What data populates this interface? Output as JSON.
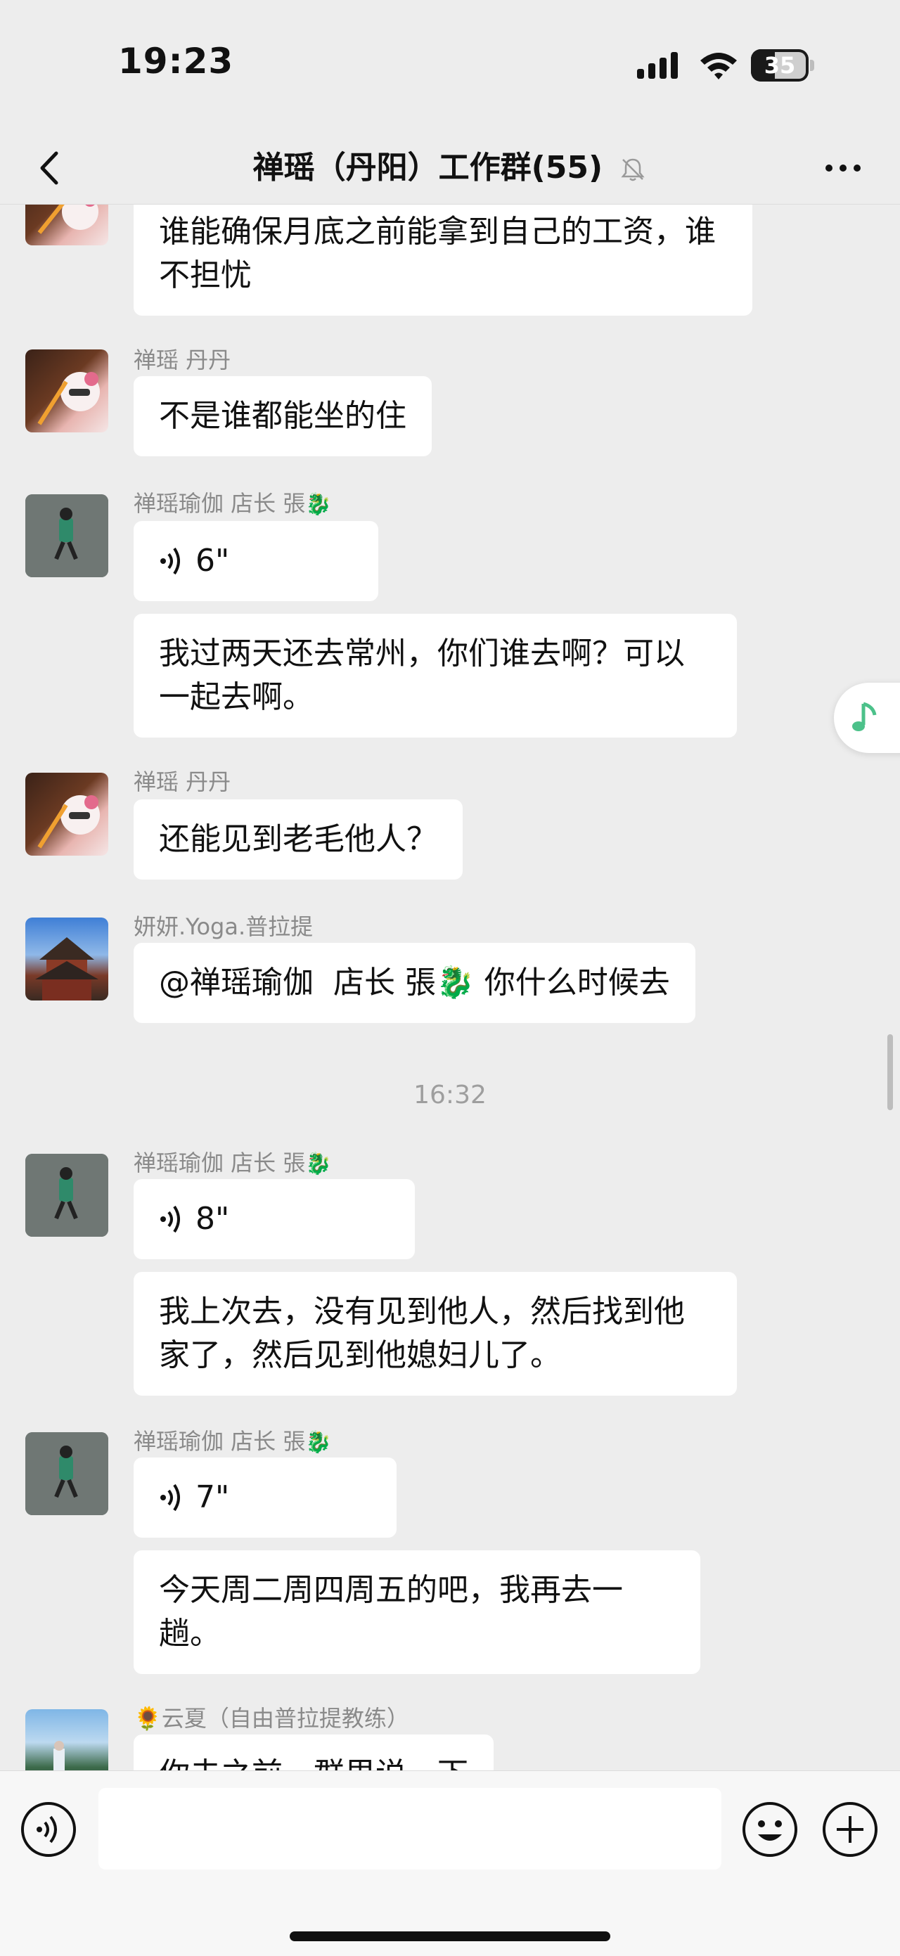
{
  "status_bar": {
    "time": "19:23",
    "battery": "35"
  },
  "header": {
    "title": "禅瑶（丹阳）工作群(55)",
    "back_icon": "chevron-left-icon",
    "mute_icon": "bell-slash-icon",
    "more_icon": "more-dots-icon"
  },
  "messages": [
    {
      "text": "谁能确保月底之前能拿到自己的工资，谁不担忧"
    },
    {
      "sender": "禅瑶 丹丹",
      "text": "不是谁都能坐的住"
    },
    {
      "sender": "禅瑶瑜伽  店长 張",
      "voice_duration": "6\""
    },
    {
      "text": "我过两天还去常州，你们谁去啊？可以一起去啊。"
    },
    {
      "sender": "禅瑶 丹丹",
      "text": "还能见到老毛他人？"
    },
    {
      "sender": "妍妍.Yoga.普拉提",
      "text_before": "@禅瑶瑜伽  店长 張",
      "text_after": " 你什么时候去"
    },
    {
      "sender": "禅瑶瑜伽  店长 張",
      "voice_duration": "8\""
    },
    {
      "text": "我上次去，没有见到他人，然后找到他家了，然后见到他媳妇儿了。"
    },
    {
      "sender": "禅瑶瑜伽  店长 張",
      "voice_duration": "7\""
    },
    {
      "text": "今天周二周四周五的吧，我再去一趟。"
    },
    {
      "sender": "🌻云夏（自由普拉提教练）",
      "text": "你去之前，群里说一下"
    }
  ],
  "timestamp": "16:32",
  "dragon_emoji": "🐉",
  "input_bar": {
    "voice_icon": "voice-toggle-icon",
    "emoji_icon": "emoji-icon",
    "plus_icon": "plus-icon"
  },
  "colors": {
    "background": "#ededed",
    "bubble": "#ffffff",
    "accent_green": "#4cc18a"
  }
}
